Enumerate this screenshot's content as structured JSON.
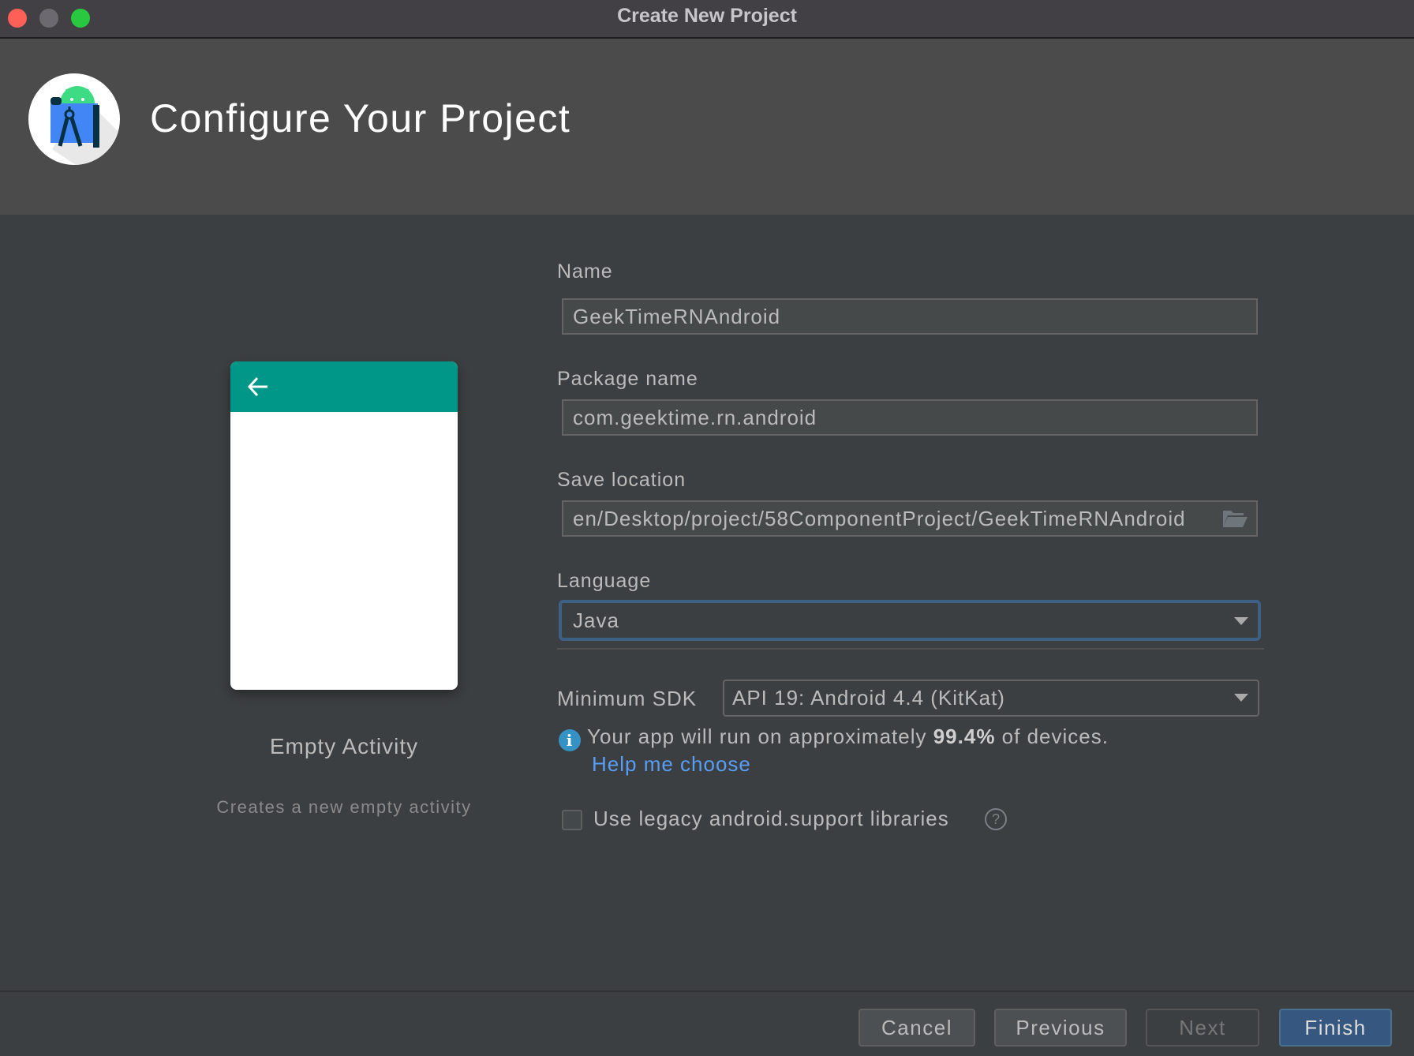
{
  "window": {
    "title": "Create New Project",
    "traffic_lights": [
      "close",
      "minimize",
      "maximize"
    ]
  },
  "header": {
    "title": "Configure Your Project",
    "logo": "android-studio-logo"
  },
  "template": {
    "name": "Empty Activity",
    "description": "Creates a new empty activity",
    "preview_icon": "back-arrow-icon",
    "accent_color": "#009688"
  },
  "form": {
    "name": {
      "label": "Name",
      "value": "GeekTimeRNAndroid"
    },
    "package": {
      "label": "Package name",
      "value": "com.geektime.rn.android"
    },
    "save_location": {
      "label": "Save location",
      "value": "en/Desktop/project/58ComponentProject/GeekTimeRNAndroid",
      "icon": "folder-icon"
    },
    "language": {
      "label": "Language",
      "value": "Java"
    },
    "min_sdk": {
      "label": "Minimum SDK",
      "value": "API 19: Android 4.4 (KitKat)"
    },
    "info": {
      "prefix": "Your app will run on approximately ",
      "percent": "99.4%",
      "suffix": " of devices.",
      "help_link": "Help me choose"
    },
    "legacy_support": {
      "label": "Use legacy android.support libraries",
      "checked": false,
      "help": "?"
    }
  },
  "buttons": {
    "cancel": "Cancel",
    "previous": "Previous",
    "next": "Next",
    "finish": "Finish"
  },
  "colors": {
    "focus_border": "#3d6185",
    "link": "#589df6",
    "primary_button": "#365880",
    "info_icon": "#3592c4"
  }
}
